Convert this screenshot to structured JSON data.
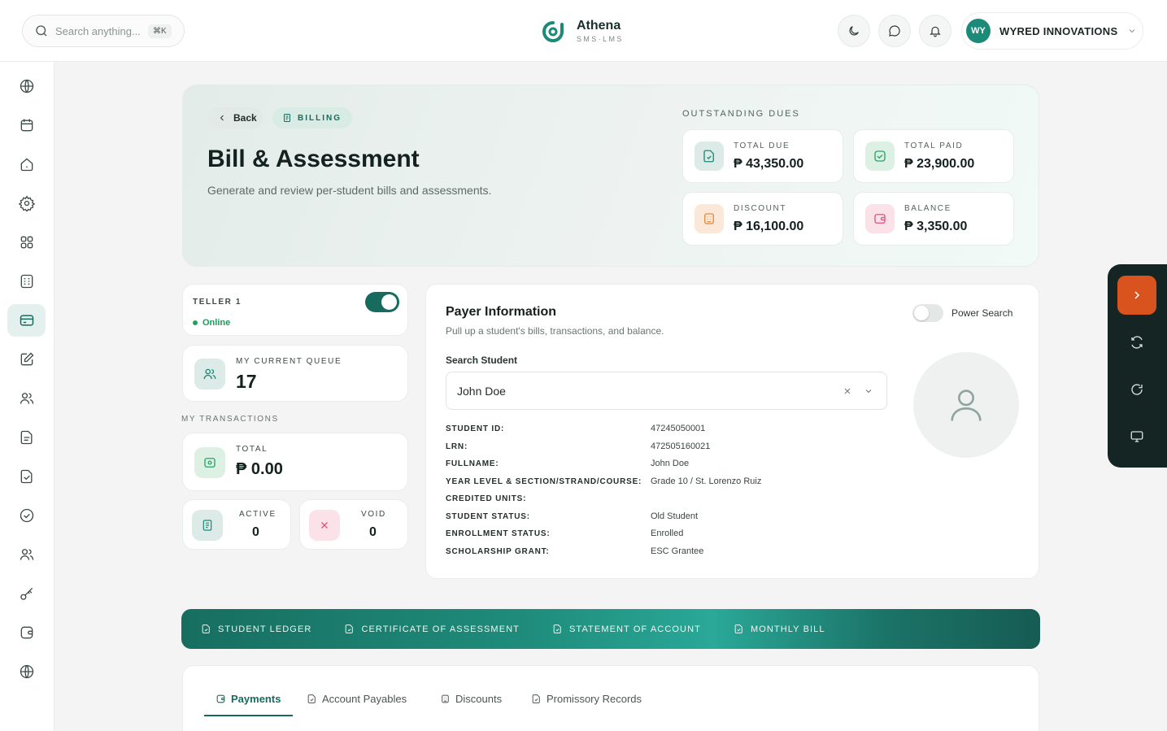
{
  "topbar": {
    "search_placeholder": "Search anything...",
    "search_shortcut": "⌘K",
    "app_name": "Athena",
    "app_tagline": "SMS·LMS",
    "user_initials": "WY",
    "user_name": "WYRED INNOVATIONS",
    "icons": [
      "moon-icon",
      "chat-icon",
      "bell-icon",
      "chevron-down-icon"
    ]
  },
  "sidebar": {
    "items": [
      {
        "icon": "globe-icon"
      },
      {
        "icon": "calendar-icon"
      },
      {
        "icon": "home-icon"
      },
      {
        "icon": "gear-icon"
      },
      {
        "icon": "apps-grid-icon"
      },
      {
        "icon": "calculator-icon"
      },
      {
        "icon": "credit-card-icon",
        "active": true
      },
      {
        "icon": "edit-icon"
      },
      {
        "icon": "users-icon"
      },
      {
        "icon": "document-icon"
      },
      {
        "icon": "document-check-icon"
      },
      {
        "icon": "shield-check-icon"
      },
      {
        "icon": "users-group-icon"
      },
      {
        "icon": "key-icon"
      },
      {
        "icon": "wallet-icon"
      },
      {
        "icon": "globe-icon"
      }
    ]
  },
  "hero": {
    "back_label": "Back",
    "badge_label": "BILLING",
    "title": "Bill & Assessment",
    "subtitle": "Generate and review per-student bills and assessments.",
    "dues_label": "OUTSTANDING DUES",
    "dues": [
      {
        "label": "TOTAL DUE",
        "value": "₱ 43,350.00",
        "icon": "document-icon",
        "color": "#1b8a78"
      },
      {
        "label": "TOTAL PAID",
        "value": "₱ 23,900.00",
        "icon": "check-square-icon",
        "color": "#27a36a"
      },
      {
        "label": "DISCOUNT",
        "value": "₱ 16,100.00",
        "icon": "calculator-icon",
        "color": "#e08a3c"
      },
      {
        "label": "BALANCE",
        "value": "₱ 3,350.00",
        "icon": "wallet-icon",
        "color": "#e0527a"
      }
    ]
  },
  "teller": {
    "name": "TELLER 1",
    "status": "Online",
    "toggle_on": true,
    "queue_label": "MY CURRENT QUEUE",
    "queue_value": "17",
    "transactions_label": "MY TRANSACTIONS",
    "total_label": "TOTAL",
    "total_value": "₱ 0.00",
    "active_label": "ACTIVE",
    "active_value": "0",
    "void_label": "VOID",
    "void_value": "0"
  },
  "payer": {
    "title": "Payer Information",
    "subtitle": "Pull up a student's bills, transactions, and balance.",
    "power_search_label": "Power Search",
    "power_search_on": false,
    "search_label": "Search Student",
    "search_value": "John Doe",
    "fields": [
      {
        "label": "STUDENT ID:",
        "value": "47245050001"
      },
      {
        "label": "LRN:",
        "value": "472505160021"
      },
      {
        "label": "FULLNAME:",
        "value": "John Doe"
      },
      {
        "label": "YEAR LEVEL & SECTION/STRAND/COURSE:",
        "value": "Grade 10 / St. Lorenzo Ruiz"
      },
      {
        "label": "CREDITED UNITS:",
        "value": ""
      },
      {
        "label": "STUDENT STATUS:",
        "value": "Old Student"
      },
      {
        "label": "ENROLLMENT STATUS:",
        "value": "Enrolled"
      },
      {
        "label": "SCHOLARSHIP GRANT:",
        "value": "ESC Grantee"
      }
    ]
  },
  "documents": [
    "STUDENT LEDGER",
    "CERTIFICATE OF ASSESSMENT",
    "STATEMENT OF ACCOUNT",
    "MONTHLY BILL"
  ],
  "tabs": [
    {
      "label": "Payments",
      "active": true
    },
    {
      "label": "Account Payables"
    },
    {
      "label": "Discounts"
    },
    {
      "label": "Promissory Records"
    }
  ],
  "rail": {
    "icons": [
      "chevron-right-icon",
      "refresh-icon",
      "rotate-icon",
      "monitor-icon"
    ],
    "accent": "#d9531e"
  }
}
